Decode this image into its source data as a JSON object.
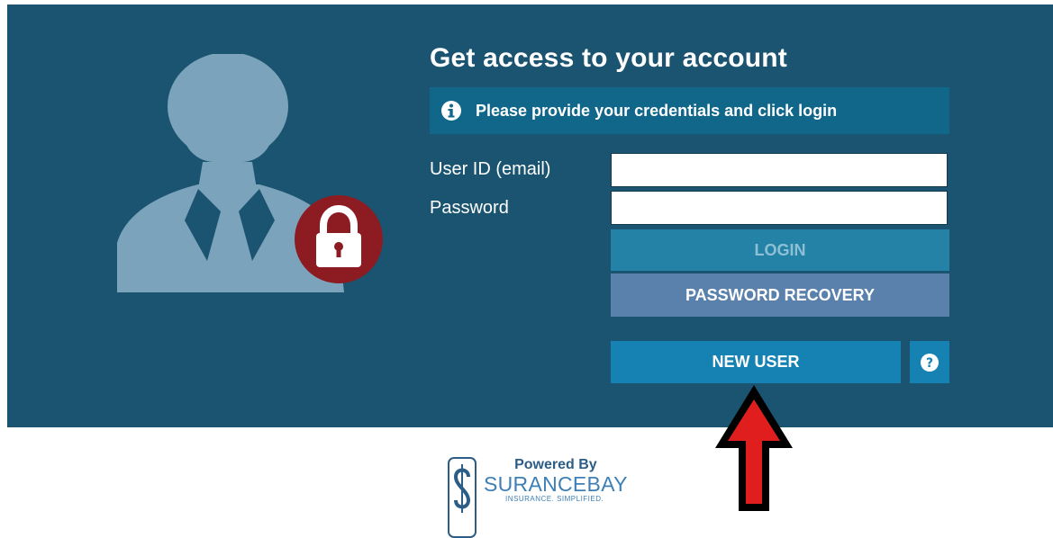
{
  "title": "Get access to your account",
  "info_message": "Please provide your credentials and click login",
  "form": {
    "user_id_label": "User ID (email)",
    "user_id_value": "",
    "password_label": "Password",
    "password_value": ""
  },
  "buttons": {
    "login": "LOGIN",
    "password_recovery": "PASSWORD RECOVERY",
    "new_user": "NEW USER",
    "help": "?"
  },
  "footer": {
    "powered_by": "Powered By",
    "brand": "SURANCEBAY",
    "tagline": "INSURANCE. SIMPLIFIED."
  },
  "colors": {
    "panel": "#1a5470",
    "info_bar": "#11678a",
    "login_button": "#2482a6",
    "recovery_button": "#5a81ac",
    "new_user_button": "#1582b3",
    "lock_badge": "#8c1c22",
    "arrow": "#e01e1e"
  },
  "icons": {
    "avatar": "user-silhouette-icon",
    "lock": "lock-icon",
    "info": "info-circle-icon",
    "help": "question-circle-icon",
    "arrow": "up-arrow-icon",
    "logo": "surancebay-logo-icon"
  }
}
